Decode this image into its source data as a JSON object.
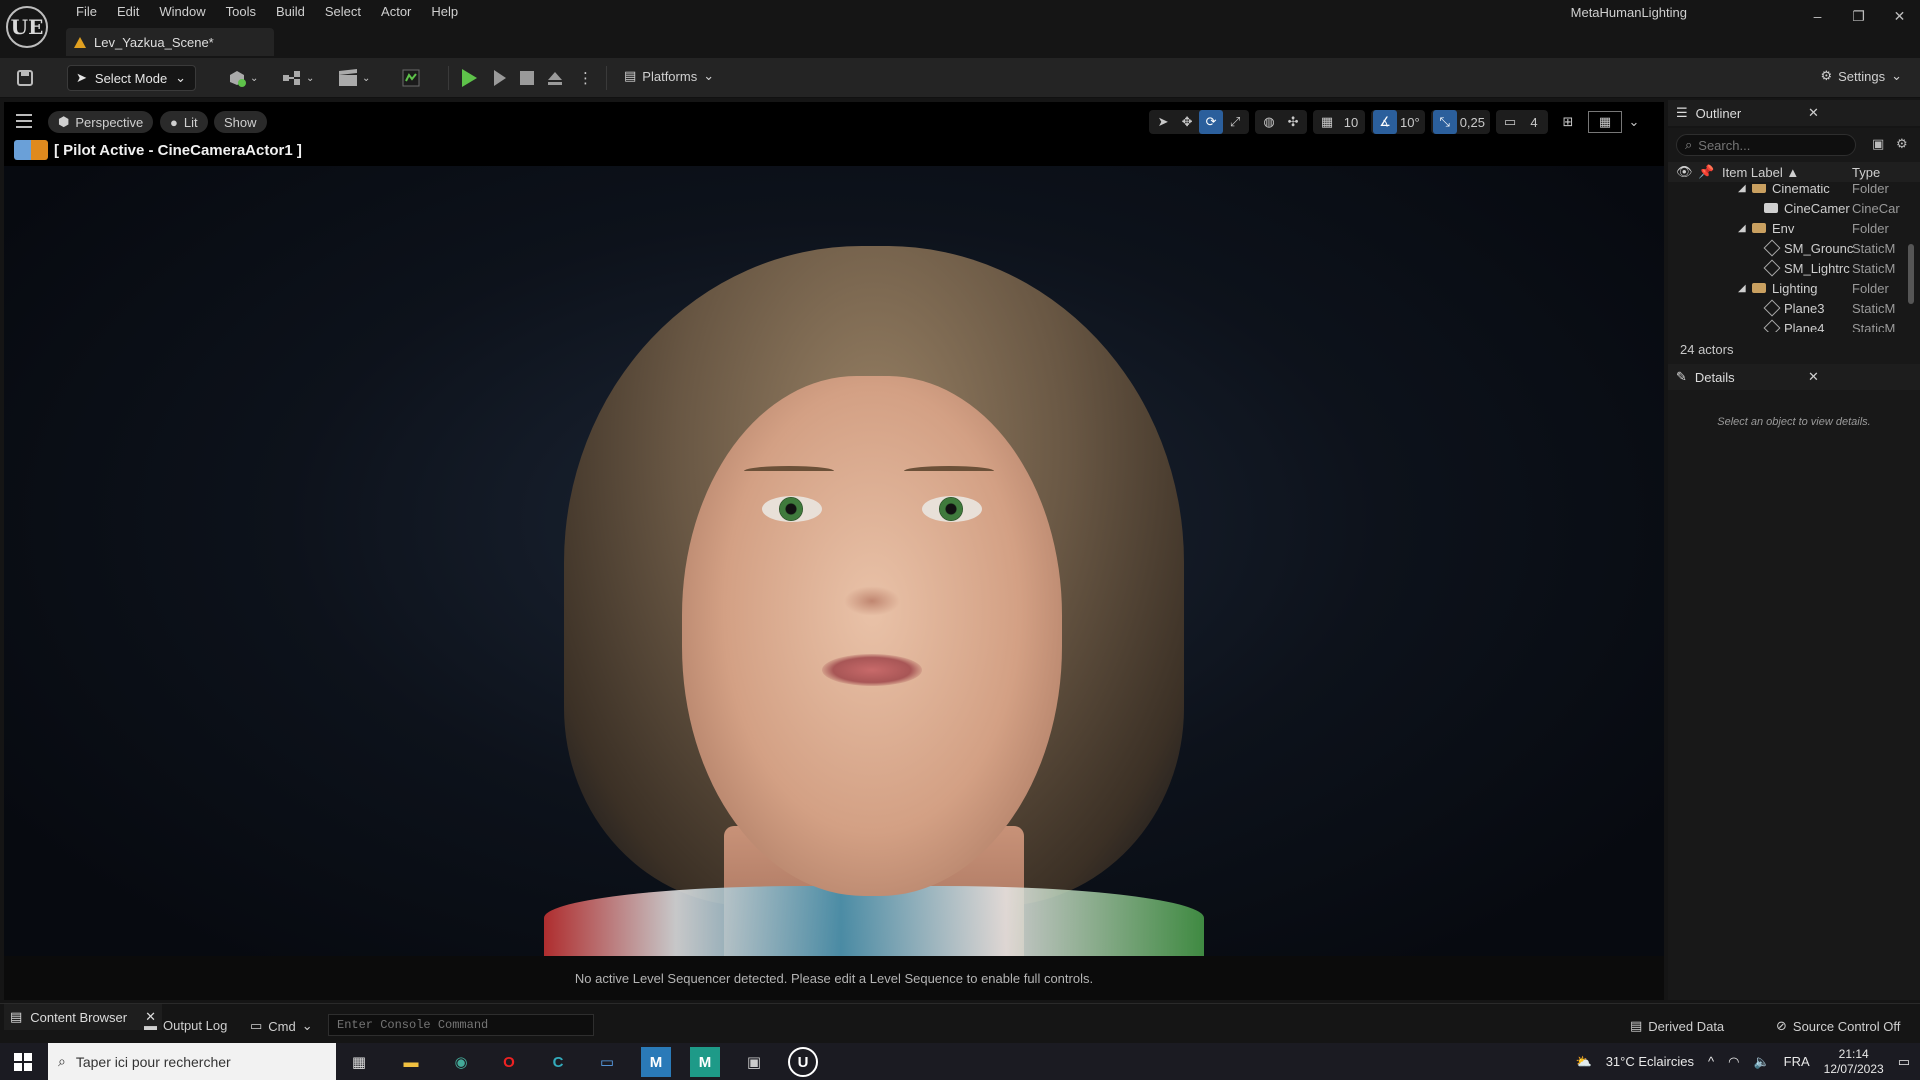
{
  "app": {
    "logo": "UE",
    "project_name": "MetaHumanLighting",
    "level_tab": "Lev_Yazkua_Scene*",
    "window_buttons": [
      "–",
      "❐",
      "✕"
    ]
  },
  "menu": [
    "File",
    "Edit",
    "Window",
    "Tools",
    "Build",
    "Select",
    "Actor",
    "Help"
  ],
  "toolbar": {
    "select_mode": "Select Mode",
    "platforms": "Platforms",
    "settings": "Settings",
    "icons": [
      "save-icon",
      "add-actor-icon",
      "blueprint-icon",
      "cinematics-icon",
      "play-icon",
      "step-icon",
      "stop-icon",
      "eject-icon"
    ]
  },
  "viewport": {
    "perspective": "Perspective",
    "lit": "Lit",
    "show": "Show",
    "pilot": "[ Pilot Active - CineCameraActor1 ]",
    "grid_snap": "10",
    "rotation_snap": "10°",
    "scale_snap": "0,25",
    "camera_speed": "4",
    "sequencer_message": "No active Level Sequencer detected. Please edit a Level Sequence to enable full controls."
  },
  "outliner": {
    "title": "Outliner",
    "search_placeholder": "Search...",
    "col_label": "Item Label ▲",
    "col_type": "Type",
    "rows": [
      {
        "label": "Cinematic",
        "type": "Folder",
        "indent": 1,
        "icon": "folder"
      },
      {
        "label": "CineCamer",
        "type": "CineCar",
        "indent": 2,
        "icon": "camera"
      },
      {
        "label": "Env",
        "type": "Folder",
        "indent": 1,
        "icon": "folder"
      },
      {
        "label": "SM_Grounc",
        "type": "StaticM",
        "indent": 2,
        "icon": "mesh"
      },
      {
        "label": "SM_Lightrc",
        "type": "StaticM",
        "indent": 2,
        "icon": "mesh"
      },
      {
        "label": "Lighting",
        "type": "Folder",
        "indent": 1,
        "icon": "folder"
      },
      {
        "label": "Plane3",
        "type": "StaticM",
        "indent": 2,
        "icon": "mesh"
      },
      {
        "label": "Plane4",
        "type": "StaticM",
        "indent": 2,
        "icon": "mesh"
      }
    ],
    "actor_count": "24 actors"
  },
  "details": {
    "title": "Details",
    "empty_message": "Select an object to view details."
  },
  "statusbar": {
    "content_browser": "Content Browser",
    "output_log": "Output Log",
    "cmd": "Cmd",
    "console_placeholder": "Enter Console Command",
    "derived_data": "Derived Data",
    "source_control": "Source Control Off"
  },
  "taskbar": {
    "search_placeholder": "Taper ici pour rechercher",
    "weather": "31°C  Eclaircies",
    "language": "FRA",
    "time": "21:14",
    "date": "12/07/2023"
  }
}
